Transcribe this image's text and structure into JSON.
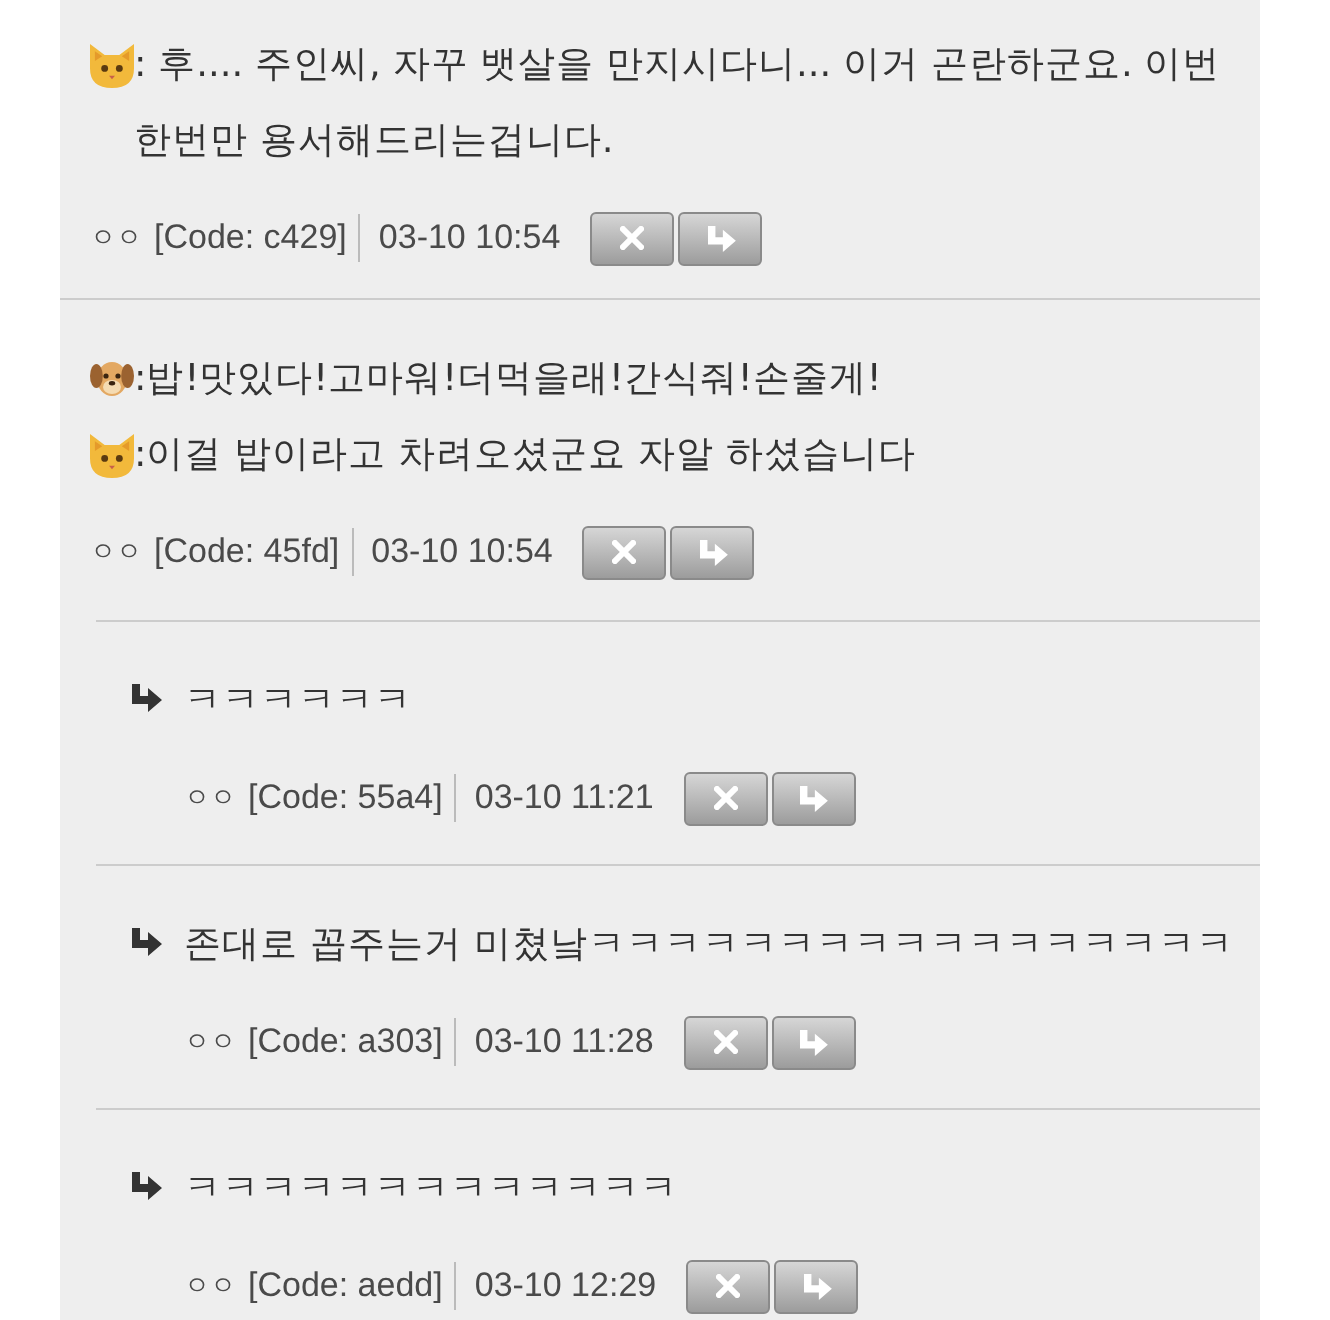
{
  "comments": [
    {
      "lines": [
        {
          "kind": "cat",
          "text": ": 후.... 주인씨, 자꾸 뱃살을 만지시다니... 이거 곤란하군요. 이번 한번만 용서해드리는겁니다."
        }
      ],
      "author": "ㅇㅇ",
      "code": "[Code: c429]",
      "time": "03-10 10:54"
    },
    {
      "lines": [
        {
          "kind": "dog",
          "text": ":밥!맛있다!고마워!더먹을래!간식줘!손줄게!"
        },
        {
          "kind": "cat",
          "text": ":이걸 밥이라고 차려오셨군요 자알 하셨습니다"
        }
      ],
      "author": "ㅇㅇ",
      "code": "[Code: 45fd]",
      "time": "03-10 10:54",
      "replies": [
        {
          "text": "ㅋㅋㅋㅋㅋㅋ",
          "author": "ㅇㅇ",
          "code": "[Code: 55a4]",
          "time": "03-10 11:21"
        },
        {
          "text": "존대로 꼽주는거 미쳤낰ㅋㅋㅋㅋㅋㅋㅋㅋㅋㅋㅋㅋㅋㅋㅋㅋㅋ",
          "author": "ㅇㅇ",
          "code": "[Code: a303]",
          "time": "03-10 11:28"
        },
        {
          "text": "ㅋㅋㅋㅋㅋㅋㅋㅋㅋㅋㅋㅋㅋ",
          "author": "ㅇㅇ",
          "code": "[Code: aedd]",
          "time": "03-10 12:29"
        }
      ]
    }
  ]
}
